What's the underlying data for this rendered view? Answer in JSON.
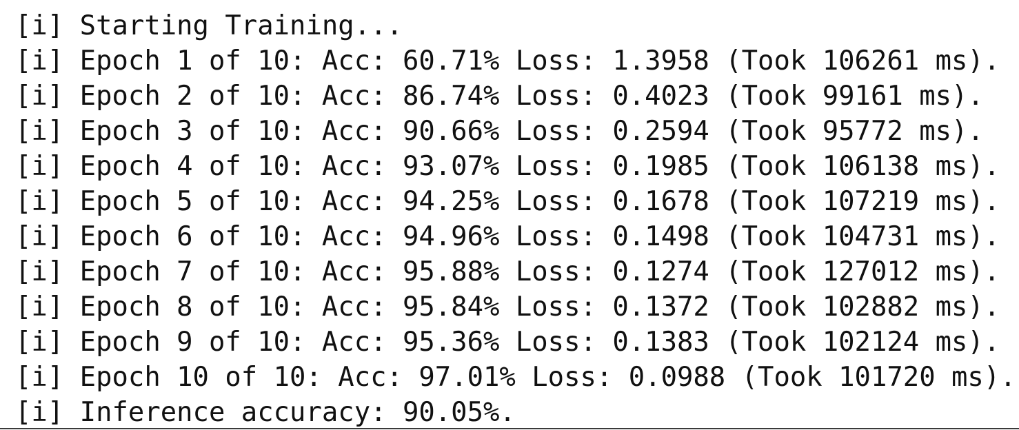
{
  "terminal": {
    "lines": [
      "[i] Starting Training...",
      "[i] Epoch 1 of 10: Acc: 60.71% Loss: 1.3958 (Took 106261 ms).",
      "[i] Epoch 2 of 10: Acc: 86.74% Loss: 0.4023 (Took 99161 ms).",
      "[i] Epoch 3 of 10: Acc: 90.66% Loss: 0.2594 (Took 95772 ms).",
      "[i] Epoch 4 of 10: Acc: 93.07% Loss: 0.1985 (Took 106138 ms).",
      "[i] Epoch 5 of 10: Acc: 94.25% Loss: 0.1678 (Took 107219 ms).",
      "[i] Epoch 6 of 10: Acc: 94.96% Loss: 0.1498 (Took 104731 ms).",
      "[i] Epoch 7 of 10: Acc: 95.88% Loss: 0.1274 (Took 127012 ms).",
      "[i] Epoch 8 of 10: Acc: 95.84% Loss: 0.1372 (Took 102882 ms).",
      "[i] Epoch 9 of 10: Acc: 95.36% Loss: 0.1383 (Took 102124 ms).",
      "[i] Epoch 10 of 10: Acc: 97.01% Loss: 0.0988 (Took 101720 ms).",
      "[i] Inference accuracy: 90.05%."
    ],
    "colors": {
      "background": "#ffffff",
      "text": "#111111"
    }
  }
}
